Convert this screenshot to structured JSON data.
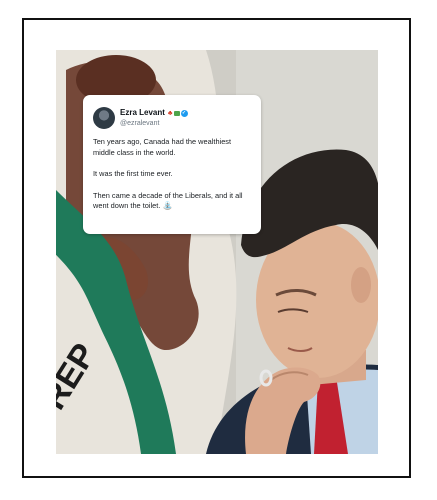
{
  "tweet": {
    "author_name": "Ezra Levant",
    "badge_icons": [
      "maple-leaf-icon",
      "money-icon",
      "verified-badge-icon"
    ],
    "handle": "@ezralevant",
    "paragraph_1": "Ten years ago, Canada had the wealthiest middle class in the world.",
    "paragraph_2": "It was the first time ever.",
    "paragraph_3": "Then came a decade of the Liberals, and it all went down the toilet.",
    "trailing_emoji": "toilet-icon"
  },
  "photo": {
    "flag_text": "REP"
  },
  "colors": {
    "verified": "#1d9bf0",
    "flag_green": "#1f7a5a",
    "flag_brown": "#6a3b2a",
    "flag_red": "#b01f2a",
    "suit": "#1f2c40",
    "tie": "#c12130"
  }
}
